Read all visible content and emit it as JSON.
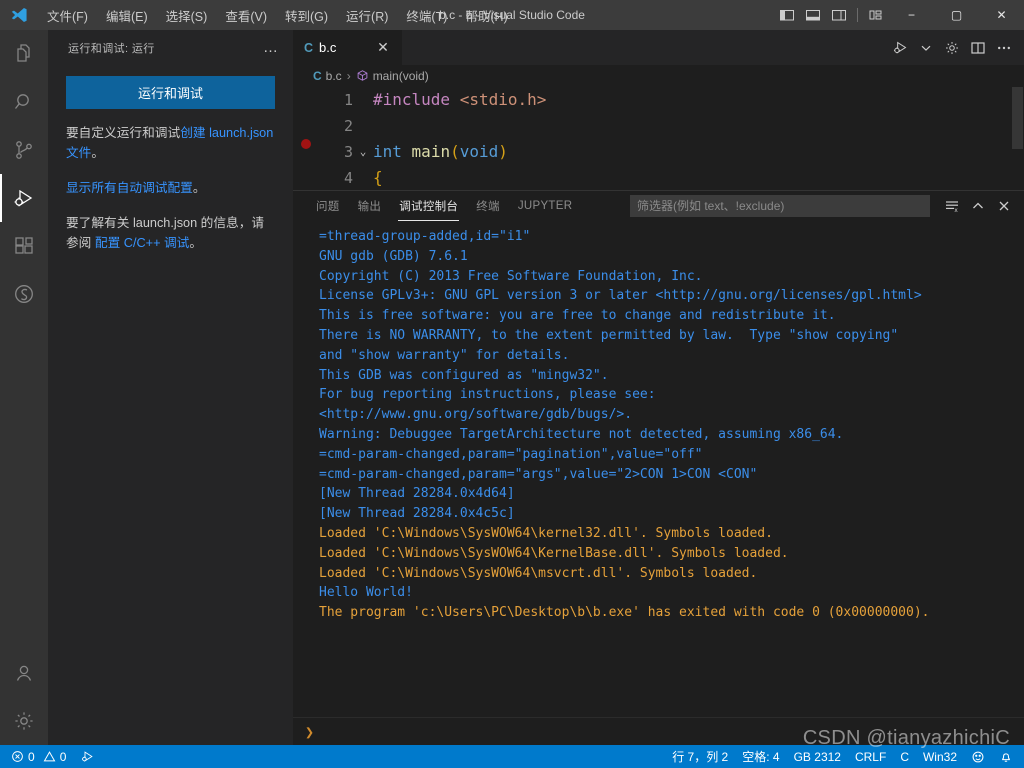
{
  "titlebar": {
    "logo_icon": "vscode-logo-icon",
    "title": "b.c - b - Visual Studio Code",
    "menus": [
      {
        "label": "文件(F)",
        "name": "menu-file"
      },
      {
        "label": "编辑(E)",
        "name": "menu-edit"
      },
      {
        "label": "选择(S)",
        "name": "menu-selection"
      },
      {
        "label": "查看(V)",
        "name": "menu-view"
      },
      {
        "label": "转到(G)",
        "name": "menu-go"
      },
      {
        "label": "运行(R)",
        "name": "menu-run"
      },
      {
        "label": "终端(T)",
        "name": "menu-terminal"
      },
      {
        "label": "帮助(H)",
        "name": "menu-help"
      }
    ],
    "layout_icons": [
      "toggle-primary-sidebar-icon",
      "toggle-panel-icon",
      "toggle-secondary-sidebar-icon",
      "customize-layout-icon"
    ],
    "window_buttons": {
      "minimize": "−",
      "maximize": "▢",
      "close": "✕"
    }
  },
  "activitybar": {
    "items": [
      {
        "name": "explorer-icon",
        "label": "资源管理器",
        "active": false
      },
      {
        "name": "search-icon",
        "label": "搜索",
        "active": false
      },
      {
        "name": "source-control-icon",
        "label": "源代码管理",
        "active": false
      },
      {
        "name": "run-and-debug-icon",
        "label": "运行和调试",
        "active": true
      },
      {
        "name": "extensions-icon",
        "label": "扩展",
        "active": false
      },
      {
        "name": "settings-sync-icon",
        "label": "同步",
        "active": false
      }
    ],
    "bottom": [
      {
        "name": "accounts-icon",
        "label": "账户"
      },
      {
        "name": "manage-gear-icon",
        "label": "管理"
      }
    ]
  },
  "sidebar": {
    "header_title": "运行和调试: 运行",
    "more_actions": "…",
    "run_button": "运行和调试",
    "paragraph1_pre": "要自定义运行和调试",
    "paragraph1_link": "创建 launch.json 文件",
    "paragraph1_post": "。",
    "paragraph2_link": "显示所有自动调试配置",
    "paragraph2_post": "。",
    "paragraph3_pre": "要了解有关 launch.json 的信息，请参阅 ",
    "paragraph3_link": "配置 C/C++ 调试",
    "paragraph3_post": "。"
  },
  "editor": {
    "tab": {
      "icon": "c-file-icon",
      "name": "b.c",
      "close": "✕"
    },
    "actions": [
      {
        "name": "run-or-debug-icon",
        "label": "运行或调试"
      },
      {
        "name": "chevron-down-icon",
        "label": "更多"
      },
      {
        "name": "gear-icon",
        "label": "设置"
      },
      {
        "name": "split-editor-icon",
        "label": "拆分编辑器"
      },
      {
        "name": "more-actions-icon",
        "label": "更多操作"
      }
    ],
    "breadcrumb": {
      "file_icon": "c-file-icon",
      "file": "b.c",
      "separator": "›",
      "symbol_icon": "symbol-method-icon",
      "symbol": "main(void)"
    },
    "lines": [
      {
        "num": "1",
        "has_breakpoint": false,
        "fold": "",
        "tokens": [
          {
            "t": "#include",
            "c": "c-pre"
          },
          {
            "t": " ",
            "c": "c-plain"
          },
          {
            "t": "<stdio.h>",
            "c": "c-str"
          }
        ]
      },
      {
        "num": "2",
        "has_breakpoint": false,
        "fold": "",
        "tokens": []
      },
      {
        "num": "3",
        "has_breakpoint": true,
        "fold": "⌄",
        "tokens": [
          {
            "t": "int",
            "c": "c-type"
          },
          {
            "t": " ",
            "c": "c-plain"
          },
          {
            "t": "main",
            "c": "c-fn"
          },
          {
            "t": "(",
            "c": "c-paren"
          },
          {
            "t": "void",
            "c": "c-kw2"
          },
          {
            "t": ")",
            "c": "c-paren"
          }
        ]
      },
      {
        "num": "4",
        "has_breakpoint": false,
        "fold": "",
        "tokens": [
          {
            "t": "{",
            "c": "c-paren"
          }
        ]
      }
    ]
  },
  "panel": {
    "tabs": [
      {
        "label": "问题",
        "name": "panel-tab-problems",
        "active": false
      },
      {
        "label": "输出",
        "name": "panel-tab-output",
        "active": false
      },
      {
        "label": "调试控制台",
        "name": "panel-tab-debug-console",
        "active": true
      },
      {
        "label": "终端",
        "name": "panel-tab-terminal",
        "active": false
      },
      {
        "label": "JUPYTER",
        "name": "panel-tab-jupyter",
        "active": false
      }
    ],
    "filter_placeholder": "筛选器(例如 text、!exclude)",
    "actions": [
      {
        "name": "clear-console-icon",
        "label": "清除控制台"
      },
      {
        "name": "collapse-panel-icon",
        "label": "折叠面板"
      },
      {
        "name": "close-panel-icon",
        "label": "关闭面板"
      }
    ],
    "console_lines": [
      {
        "text": "=thread-group-added,id=\"i1\"",
        "color": "blue"
      },
      {
        "text": "GNU gdb (GDB) 7.6.1",
        "color": "blue"
      },
      {
        "text": "Copyright (C) 2013 Free Software Foundation, Inc.",
        "color": "blue"
      },
      {
        "text": "License GPLv3+: GNU GPL version 3 or later <http://gnu.org/licenses/gpl.html>",
        "color": "blue"
      },
      {
        "text": "This is free software: you are free to change and redistribute it.",
        "color": "blue"
      },
      {
        "text": "There is NO WARRANTY, to the extent permitted by law.  Type \"show copying\"",
        "color": "blue"
      },
      {
        "text": "and \"show warranty\" for details.",
        "color": "blue"
      },
      {
        "text": "This GDB was configured as \"mingw32\".",
        "color": "blue"
      },
      {
        "text": "For bug reporting instructions, please see:",
        "color": "blue"
      },
      {
        "text": "<http://www.gnu.org/software/gdb/bugs/>.",
        "color": "blue"
      },
      {
        "text": "Warning: Debuggee TargetArchitecture not detected, assuming x86_64.",
        "color": "blue"
      },
      {
        "text": "=cmd-param-changed,param=\"pagination\",value=\"off\"",
        "color": "blue"
      },
      {
        "text": "=cmd-param-changed,param=\"args\",value=\"2>CON 1>CON <CON\"",
        "color": "blue"
      },
      {
        "text": "[New Thread 28284.0x4d64]",
        "color": "blue"
      },
      {
        "text": "[New Thread 28284.0x4c5c]",
        "color": "blue"
      },
      {
        "text": "Loaded 'C:\\Windows\\SysWOW64\\kernel32.dll'. Symbols loaded.",
        "color": "orange"
      },
      {
        "text": "Loaded 'C:\\Windows\\SysWOW64\\KernelBase.dll'. Symbols loaded.",
        "color": "orange"
      },
      {
        "text": "Loaded 'C:\\Windows\\SysWOW64\\msvcrt.dll'. Symbols loaded.",
        "color": "orange"
      },
      {
        "text": "Hello World!",
        "color": "blue"
      },
      {
        "text": "The program 'c:\\Users\\PC\\Desktop\\b\\b.exe' has exited with code 0 (0x00000000).",
        "color": "orange"
      }
    ],
    "input_prompt": "❯",
    "input_value": ""
  },
  "statusbar": {
    "error_icon": "error-circle-icon",
    "error_count": "0",
    "warning_icon": "warning-triangle-icon",
    "warning_count": "0",
    "debug_icon": "run-debug-status-icon",
    "right_items": [
      {
        "label": "行 7，列 2",
        "name": "status-cursor-position"
      },
      {
        "label": "空格: 4",
        "name": "status-indentation"
      },
      {
        "label": "GB 2312",
        "name": "status-encoding"
      },
      {
        "label": "CRLF",
        "name": "status-eol"
      },
      {
        "label": "C",
        "name": "status-language-mode"
      },
      {
        "label": "Win32",
        "name": "status-platform"
      }
    ],
    "feedback_icon": "smiley-feedback-icon",
    "bell_icon": "notifications-bell-icon"
  },
  "watermark": "CSDN @tianyazhichiC",
  "colors": {
    "accent_blue": "#007acc",
    "button_blue": "#0e639c",
    "link_blue": "#3794ff",
    "console_blue": "#3b8eea",
    "console_orange": "#e5a13a",
    "breakpoint_red": "#a11313"
  }
}
